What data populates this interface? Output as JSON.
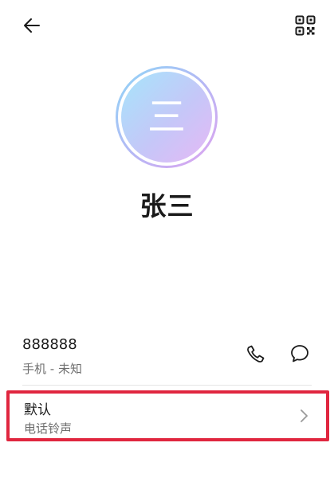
{
  "header": {
    "back_icon": "arrow-left-icon",
    "qr_icon": "qr-code-icon"
  },
  "contact": {
    "avatar_initial": "三",
    "name": "张三",
    "avatar_colors": [
      "#a6e5fb",
      "#c5c7f8",
      "#e6b8f5"
    ]
  },
  "phone": {
    "number": "888888",
    "meta": "手机 - 未知",
    "call_icon": "phone-icon",
    "message_icon": "chat-bubble-icon"
  },
  "ringtone": {
    "value": "默认",
    "label": "电话铃声",
    "chevron_icon": "chevron-right-icon",
    "highlight_color": "#e0263f"
  }
}
